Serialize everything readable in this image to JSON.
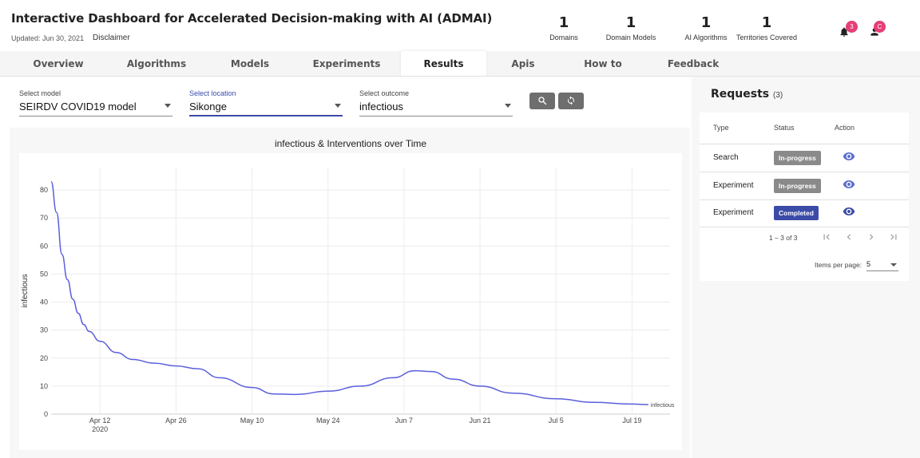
{
  "header": {
    "title": "Interactive Dashboard for Accelerated Decision-making with AI (ADMAI)",
    "updated": "Updated: Jun 30, 2021",
    "disclaimer": "Disclaimer",
    "stats": [
      {
        "value": "1",
        "label": "Domains"
      },
      {
        "value": "1",
        "label": "Domain Models"
      },
      {
        "value": "1",
        "label": "AI Algorithms"
      },
      {
        "value": "1",
        "label": "Territories Covered"
      }
    ],
    "notifications_count": "3",
    "user_initial": "C"
  },
  "tabs": [
    "Overview",
    "Algorithms",
    "Models",
    "Experiments",
    "Results",
    "Apis",
    "How to",
    "Feedback"
  ],
  "active_tab": "Results",
  "filters": {
    "model": {
      "label": "Select model",
      "value": "SEIRDV COVID19 model"
    },
    "location": {
      "label": "Select location",
      "value": "Sikonge"
    },
    "outcome": {
      "label": "Select outcome",
      "value": "infectious"
    }
  },
  "buttons": {
    "search_icon": "search-icon",
    "refresh_icon": "refresh-icon"
  },
  "requests": {
    "title": "Requests",
    "count": "(3)",
    "columns": [
      "Type",
      "Status",
      "Action"
    ],
    "rows": [
      {
        "type": "Search",
        "status": "In-progress",
        "status_color": "#8a8a8a"
      },
      {
        "type": "Experiment",
        "status": "In-progress",
        "status_color": "#8a8a8a"
      },
      {
        "type": "Experiment",
        "status": "Completed",
        "status_color": "#3b4ba8"
      }
    ],
    "range": "1 – 3 of 3",
    "items_per_page_label": "Items per page:",
    "items_per_page": "5"
  },
  "chart_data": {
    "type": "line",
    "title": "infectious & Interventions over Time",
    "ylabel": "infectious",
    "xlabel": "",
    "ylim": [
      0,
      88
    ],
    "yticks": [
      0,
      10,
      20,
      30,
      40,
      50,
      60,
      70,
      80
    ],
    "xticks": [
      {
        "date": "2020-04-12",
        "label": "Apr 12",
        "sub": "2020"
      },
      {
        "date": "2020-04-26",
        "label": "Apr 26",
        "sub": ""
      },
      {
        "date": "2020-05-10",
        "label": "May 10",
        "sub": ""
      },
      {
        "date": "2020-05-24",
        "label": "May 24",
        "sub": ""
      },
      {
        "date": "2020-06-07",
        "label": "Jun 7",
        "sub": ""
      },
      {
        "date": "2020-06-21",
        "label": "Jun 21",
        "sub": ""
      },
      {
        "date": "2020-07-05",
        "label": "Jul 5",
        "sub": ""
      },
      {
        "date": "2020-07-19",
        "label": "Jul 19",
        "sub": ""
      }
    ],
    "xlim": [
      "2020-04-03",
      "2020-07-26"
    ],
    "series": [
      {
        "name": "infectious",
        "color": "#5b5fdc",
        "points": [
          [
            "2020-04-03",
            83
          ],
          [
            "2020-04-04",
            72
          ],
          [
            "2020-04-05",
            57
          ],
          [
            "2020-04-06",
            48
          ],
          [
            "2020-04-07",
            41
          ],
          [
            "2020-04-08",
            36
          ],
          [
            "2020-04-09",
            32
          ],
          [
            "2020-04-10",
            29.5
          ],
          [
            "2020-04-12",
            26
          ],
          [
            "2020-04-15",
            22
          ],
          [
            "2020-04-18",
            19.5
          ],
          [
            "2020-04-22",
            18.2
          ],
          [
            "2020-04-26",
            17.2
          ],
          [
            "2020-04-30",
            16.2
          ],
          [
            "2020-05-04",
            13
          ],
          [
            "2020-05-10",
            9.5
          ],
          [
            "2020-05-14",
            7.2
          ],
          [
            "2020-05-18",
            7.0
          ],
          [
            "2020-05-24",
            8.2
          ],
          [
            "2020-05-30",
            10
          ],
          [
            "2020-06-05",
            13
          ],
          [
            "2020-06-09",
            15.5
          ],
          [
            "2020-06-12",
            15.2
          ],
          [
            "2020-06-16",
            12.5
          ],
          [
            "2020-06-21",
            10
          ],
          [
            "2020-06-27",
            7.5
          ],
          [
            "2020-07-05",
            5.5
          ],
          [
            "2020-07-12",
            4.2
          ],
          [
            "2020-07-19",
            3.6
          ],
          [
            "2020-07-22",
            3.4
          ]
        ]
      }
    ]
  }
}
